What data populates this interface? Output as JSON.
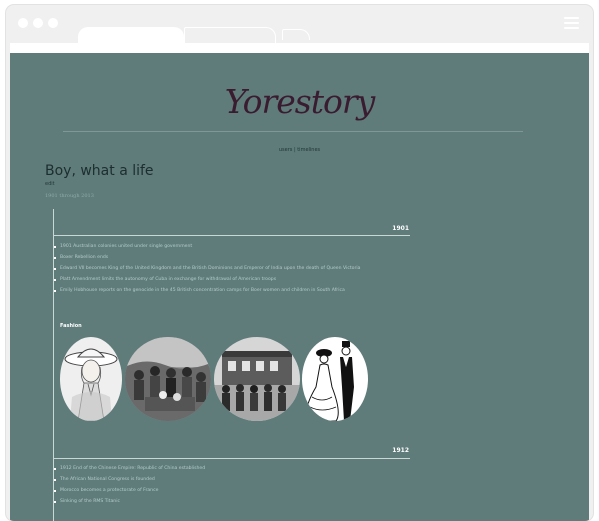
{
  "browser": {
    "tabs": [
      "",
      "",
      ""
    ]
  },
  "site": {
    "logo": "Yorestory",
    "nav": "users | timelines"
  },
  "timeline": {
    "title": "Boy, what a life",
    "edit_label": "edit",
    "range": "1901 through 2013"
  },
  "sections": [
    {
      "year": "1901",
      "events": [
        "1901 Australian colonies united under single government",
        "Boxer Rebellion ends",
        "Edward VII becomes King of the United Kingdom and the British Dominions and Emperor of India upon the death of Queen Victoria",
        "Platt Amendment limits the autonomy of Cuba in exchange for withdrawal of American troops",
        "Emily Hobhouse reports on the genocide in the 45 British concentration camps for Boer women and children in South Africa"
      ],
      "category": "Fashion",
      "images": [
        "woman-in-hat",
        "crowd-gathering",
        "group-by-building",
        "couple-illustration"
      ]
    },
    {
      "year": "1912",
      "events": [
        "1912 End of the Chinese Empire: Republic of China established",
        "The African National Congress is founded",
        "Morocco becomes a protectorate of France",
        "Sinking of the RMS Titanic"
      ]
    }
  ],
  "colors": {
    "page_bg": "#5f7c7b",
    "logo": "#3a1c30",
    "event_text": "#b4cbca"
  }
}
